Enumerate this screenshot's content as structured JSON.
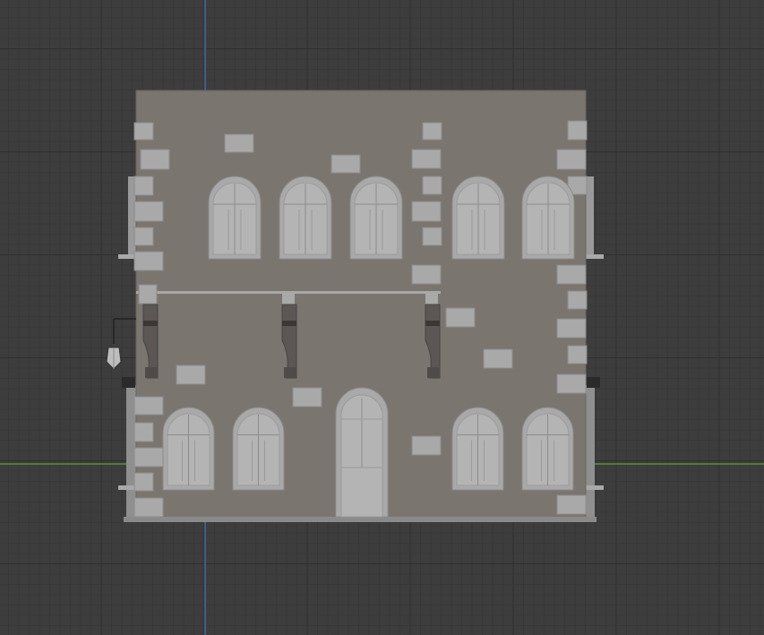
{
  "viewport": {
    "view": "front-orthographic",
    "background_color": "#3d3d3d",
    "grid": true,
    "grid_color_minor": "#363636",
    "grid_color_major": "#2f2f2f",
    "axis_z_color": "#4a72b8",
    "axis_x_color": "#6f9a2f"
  },
  "model": {
    "object": "building-facade",
    "wall_color": "#7b7570",
    "trim_color": "#a9a9a9",
    "window_color": "#b4b4b4",
    "shadow_color": "#5c5754",
    "upper_windows": 5,
    "lower_windows": 4,
    "doors": 1,
    "balcony_brackets": 3,
    "hanging_lanterns": 1
  }
}
